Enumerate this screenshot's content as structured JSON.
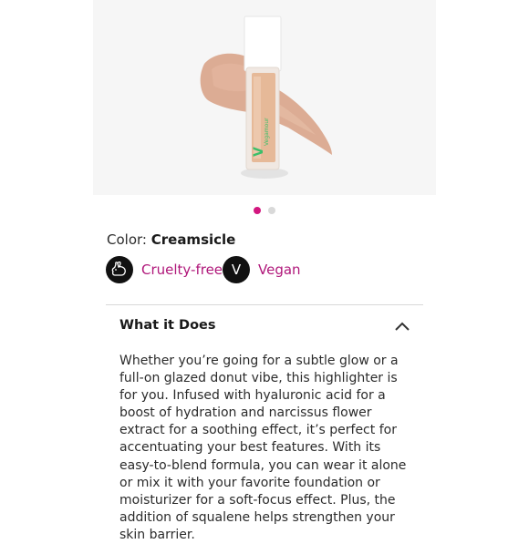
{
  "product": {
    "image_brand_text": "Vegamour",
    "carousel": {
      "total": 2,
      "active_index": 0
    }
  },
  "color": {
    "label": "Color:",
    "value": "Creamsicle"
  },
  "attributes": [
    {
      "label": "Cruelty-free",
      "icon": "bunny-icon"
    },
    {
      "label": "Vegan",
      "icon": "vegan-v-icon",
      "glyph": "V"
    }
  ],
  "accordion": {
    "title": "What it Does",
    "expanded": true,
    "description": "Whether you’re going for a subtle glow or a full-on glazed donut vibe, this highlighter is for you. Infused with hyaluronic acid for a boost of hydration and narcissus flower extract for a soothing effect, it’s perfect for accentuating your best features. With its easy-to-blend formula, you can wear it alone or mix it with your favorite foundation or moisturizer for a soft-focus effect. Plus, the addition of squalene helps strengthen your skin barrier."
  },
  "colors": {
    "accent": "#d3177f",
    "attribute_text": "#b0177a",
    "icon_bg": "#111111"
  }
}
